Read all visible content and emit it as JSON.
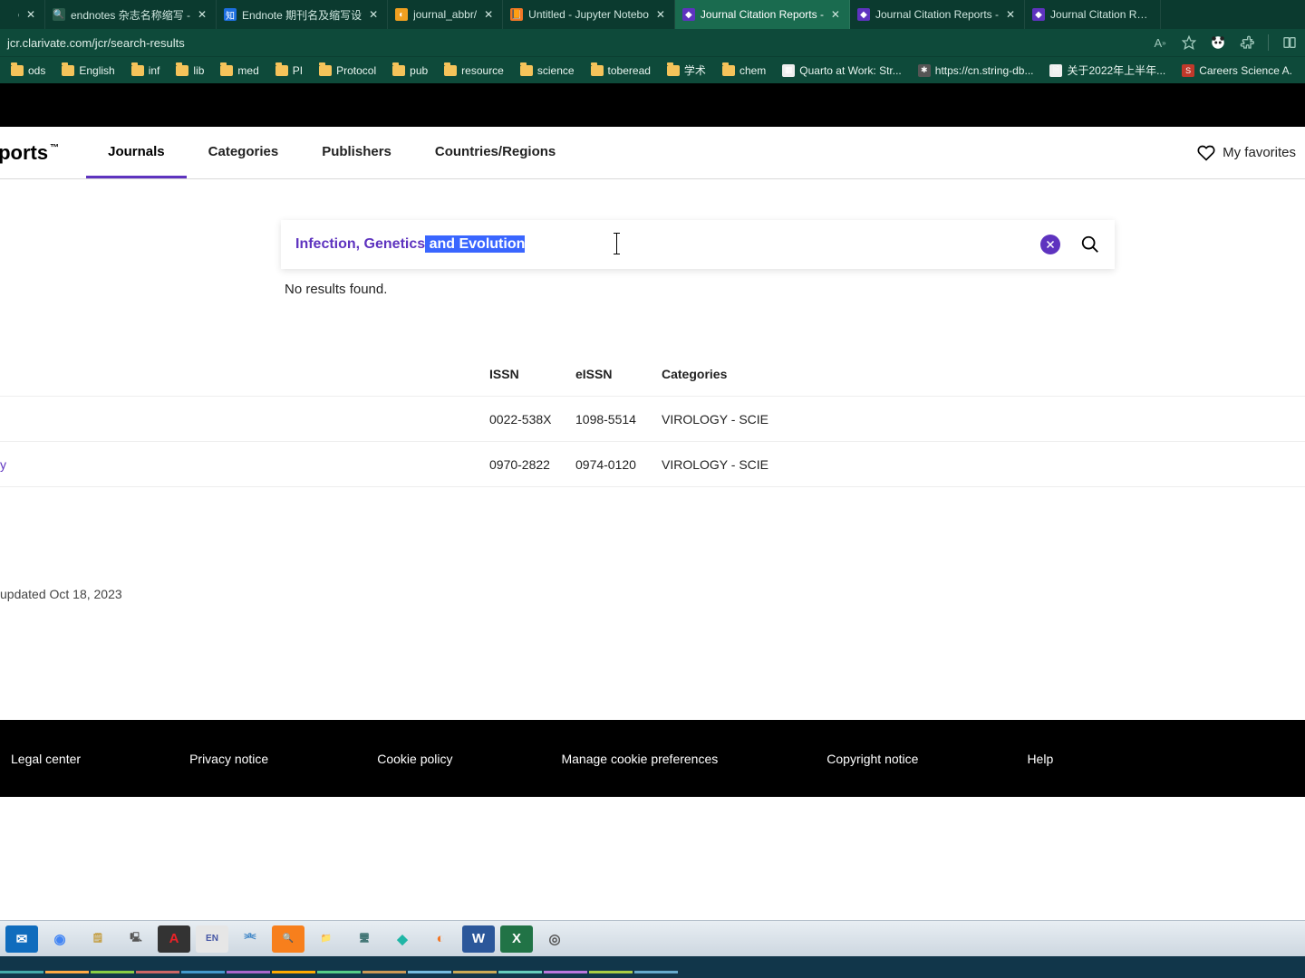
{
  "browser": {
    "url": "jcr.clarivate.com/jcr/search-results",
    "tabs": [
      {
        "title": "c of t",
        "icon": "",
        "iconBg": "#0b3a2f",
        "close": "✕",
        "type": "partial-left"
      },
      {
        "title": "endnotes 杂志名称缩写 -",
        "icon": "🔍",
        "iconBg": "#2a5c4c",
        "close": "✕"
      },
      {
        "title": "Endnote 期刊名及缩写设",
        "icon": "知",
        "iconBg": "#1d6fe0",
        "close": "✕"
      },
      {
        "title": "journal_abbr/",
        "icon": "◐",
        "iconBg": "#f0a020",
        "close": "✕"
      },
      {
        "title": "Untitled - Jupyter Notebo",
        "icon": "📙",
        "iconBg": "#f37726",
        "close": "✕"
      },
      {
        "title": "Journal Citation Reports -",
        "icon": "◆",
        "iconBg": "#5e33bf",
        "close": "✕",
        "active": true
      },
      {
        "title": "Journal Citation Reports -",
        "icon": "◆",
        "iconBg": "#5e33bf",
        "close": "✕"
      },
      {
        "title": "Journal Citation Reports -",
        "icon": "◆",
        "iconBg": "#5e33bf",
        "close": "",
        "type": "partial-right"
      }
    ]
  },
  "bookmarks": [
    {
      "label": "ods",
      "type": "folder"
    },
    {
      "label": "English",
      "type": "folder"
    },
    {
      "label": "inf",
      "type": "folder"
    },
    {
      "label": "lib",
      "type": "folder"
    },
    {
      "label": "med",
      "type": "folder"
    },
    {
      "label": "PI",
      "type": "folder"
    },
    {
      "label": "Protocol",
      "type": "folder"
    },
    {
      "label": "pub",
      "type": "folder"
    },
    {
      "label": "resource",
      "type": "folder"
    },
    {
      "label": "science",
      "type": "folder"
    },
    {
      "label": "toberead",
      "type": "folder"
    },
    {
      "label": "学术",
      "type": "folder"
    },
    {
      "label": "chem",
      "type": "folder"
    },
    {
      "label": "Quarto at Work: Str...",
      "type": "page",
      "iconBg": "#eee",
      "icon": "▦"
    },
    {
      "label": "https://cn.string-db...",
      "type": "page",
      "iconBg": "#555",
      "icon": "✱"
    },
    {
      "label": "关于2022年上半年...",
      "type": "page",
      "iconBg": "#eee",
      "icon": "🗎"
    },
    {
      "label": "Careers  Science  A.",
      "type": "page",
      "iconBg": "#c0392b",
      "icon": "S"
    }
  ],
  "nav": {
    "logo": "Reports",
    "items": [
      "Journals",
      "Categories",
      "Publishers",
      "Countries/Regions"
    ],
    "activeIndex": 0,
    "favorites": "My favorites"
  },
  "search": {
    "textPlain": "Infection, Genetics",
    "textSelected": " and Evolution",
    "noResults": "No results found."
  },
  "table": {
    "headers": {
      "issn": "ISSN",
      "eissn": "eISSN",
      "categories": "Categories"
    },
    "rows": [
      {
        "journal": "",
        "issn": "0022-538X",
        "eissn": "1098-5514",
        "categories": "VIROLOGY - SCIE"
      },
      {
        "journal": "y",
        "issn": "0970-2822",
        "eissn": "0974-0120",
        "categories": "VIROLOGY - SCIE"
      }
    ]
  },
  "updated": "updated Oct 18, 2023",
  "footer": [
    "Legal center",
    "Privacy notice",
    "Cookie policy",
    "Manage cookie preferences",
    "Copyright notice",
    "Help"
  ],
  "taskbar": [
    {
      "name": "mail",
      "bg": "#0f6cbd",
      "glyph": "✉",
      "color": "#fff"
    },
    {
      "name": "chrome",
      "bg": "",
      "glyph": "◉",
      "color": "#4285f4"
    },
    {
      "name": "note",
      "bg": "",
      "glyph": "🗒",
      "color": "#c39b3b"
    },
    {
      "name": "terminal",
      "bg": "",
      "glyph": "🖳",
      "color": "#555"
    },
    {
      "name": "adobe",
      "bg": "#333",
      "glyph": "A",
      "color": "#ec2227"
    },
    {
      "name": "endnote",
      "bg": "#e6e6e6",
      "glyph": "EN",
      "color": "#4354a4"
    },
    {
      "name": "gene",
      "bg": "",
      "glyph": "⎃",
      "color": "#3c84c6"
    },
    {
      "name": "everything",
      "bg": "#f77f1c",
      "glyph": "🔍",
      "color": "#fff"
    },
    {
      "name": "explorer",
      "bg": "",
      "glyph": "📁",
      "color": "#f5c35a"
    },
    {
      "name": "db",
      "bg": "",
      "glyph": "🖥",
      "color": "#477"
    },
    {
      "name": "pycharm",
      "bg": "",
      "glyph": "◆",
      "color": "#1fb6a6"
    },
    {
      "name": "jupyter",
      "bg": "",
      "glyph": "◐",
      "color": "#f37726"
    },
    {
      "name": "word",
      "bg": "#2b579a",
      "glyph": "W",
      "color": "#fff"
    },
    {
      "name": "excel",
      "bg": "#217346",
      "glyph": "X",
      "color": "#fff"
    },
    {
      "name": "obs",
      "bg": "",
      "glyph": "◎",
      "color": "#555"
    }
  ]
}
